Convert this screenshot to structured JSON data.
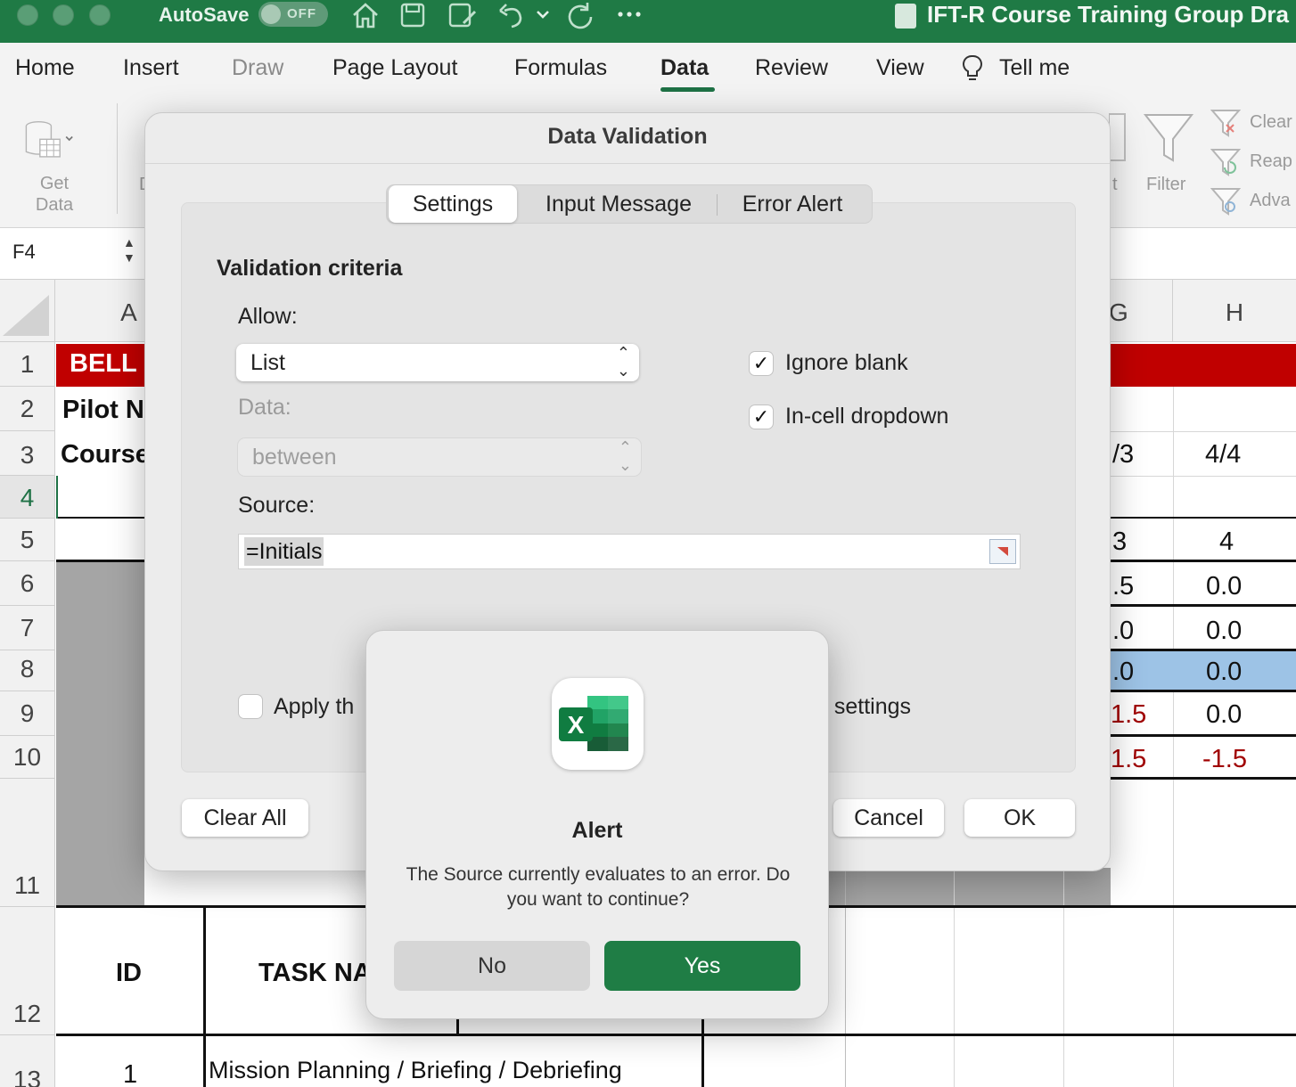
{
  "titlebar": {
    "autosave_label": "AutoSave",
    "autosave_state": "OFF",
    "doc_title": "IFT-R Course Training Group Dra"
  },
  "ribbon_tabs": [
    "Home",
    "Insert",
    "Draw",
    "Page Layout",
    "Formulas",
    "Data",
    "Review",
    "View",
    "Tell me"
  ],
  "active_tab": "Data",
  "ribbon": {
    "get_data_line1": "Get",
    "get_data_line2": "Data",
    "partial_d": "D",
    "partial_sort": "t",
    "filter": "Filter",
    "clear": "Clear",
    "reapply": "Reap",
    "advanced": "Adva"
  },
  "formula_bar": {
    "name_box": "F4"
  },
  "grid": {
    "col_headers": {
      "a": "A",
      "g": "G",
      "h": "H"
    },
    "row_headers": [
      "1",
      "2",
      "3",
      "4",
      "5",
      "6",
      "7",
      "8",
      "9",
      "10",
      "11",
      "12",
      "13"
    ],
    "cells": {
      "a1": "BELL E",
      "a2": "Pilot N",
      "a3": "Course",
      "g3": "/3",
      "h3": "4/4",
      "g5": "3",
      "h5": "4",
      "g6": ".5",
      "h6": "0.0",
      "g7": ".0",
      "h7": "0.0",
      "g8": ".0",
      "h8": "0.0",
      "g9": "1.5",
      "h9": "0.0",
      "g10": "1.5",
      "h10": "-1.5",
      "id_header": "ID",
      "task_header": "TASK NA",
      "row13_id": "1",
      "row13_task": "Mission Planning / Briefing / Debriefing"
    },
    "colors": {
      "header_red": "#c00000",
      "negative_red": "#a00000",
      "selected_blue": "#9dc3e6"
    }
  },
  "data_validation": {
    "title": "Data Validation",
    "tabs": [
      "Settings",
      "Input Message",
      "Error Alert"
    ],
    "active_tab": "Settings",
    "section_title": "Validation criteria",
    "allow_label": "Allow:",
    "allow_value": "List",
    "data_label": "Data:",
    "data_value": "between",
    "ignore_blank_label": "Ignore blank",
    "ignore_blank_checked": true,
    "in_cell_dropdown_label": "In-cell dropdown",
    "in_cell_dropdown_checked": true,
    "source_label": "Source:",
    "source_value": "=Initials",
    "apply_label_left": "Apply th",
    "apply_label_right": "e settings",
    "apply_checked": false,
    "clear_all": "Clear All",
    "cancel": "Cancel",
    "ok": "OK"
  },
  "alert": {
    "title": "Alert",
    "message": "The Source currently evaluates to an error. Do you want to continue?",
    "no": "No",
    "yes": "Yes",
    "icon_letter": "X",
    "accent": "#1f7d45"
  }
}
